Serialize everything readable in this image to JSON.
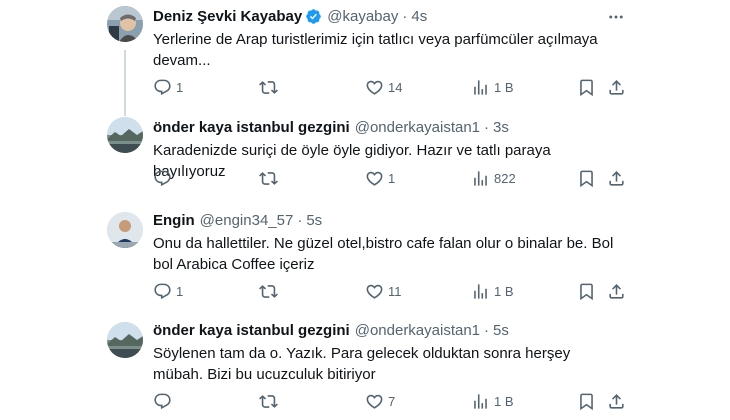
{
  "tweets": [
    {
      "name": "Deniz Şevki Kayabay",
      "verified": true,
      "handle": "@kayabay",
      "sep": "·",
      "time": "4s",
      "text": "Yerlerine de Arap turistlerimiz için tatlıcı veya parfümcüler açılmaya devam...",
      "replies": "1",
      "retweets": "",
      "likes": "14",
      "views": "1 B"
    },
    {
      "name": "önder kaya istanbul gezgini",
      "verified": false,
      "handle": "@onderkayaistan1",
      "sep": "·",
      "time": "3s",
      "text": "Karadenizde suriçi de öyle öyle gidiyor. Hazır ve tatlı paraya bayılıyoruz",
      "replies": "",
      "retweets": "",
      "likes": "1",
      "views": "822"
    },
    {
      "name": "Engin",
      "verified": false,
      "handle": "@engin34_57",
      "sep": "·",
      "time": "5s",
      "text": "Onu da hallettiler. Ne güzel otel,bistro cafe falan olur o binalar be. Bol bol Arabica Coffee içeriz",
      "replies": "1",
      "retweets": "",
      "likes": "11",
      "views": "1 B"
    },
    {
      "name": "önder kaya istanbul gezgini",
      "verified": false,
      "handle": "@onderkayaistan1",
      "sep": "·",
      "time": "5s",
      "text": "Söylenen tam da o. Yazık. Para gelecek olduktan sonra herşey mübah. Bizi bu ucuzculuk bitiriyor",
      "replies": "",
      "retweets": "",
      "likes": "7",
      "views": "1 B"
    }
  ],
  "icons": {
    "reply": "reply-icon",
    "retweet": "retweet-icon",
    "like": "heart-icon",
    "views": "views-icon",
    "bookmark": "bookmark-icon",
    "share": "share-icon",
    "more": "more-icon",
    "verified": "verified-badge-icon"
  },
  "colors": {
    "text": "#0f1419",
    "muted": "#536471",
    "verified": "#1d9bf0",
    "thread_line": "#cfd9de"
  }
}
